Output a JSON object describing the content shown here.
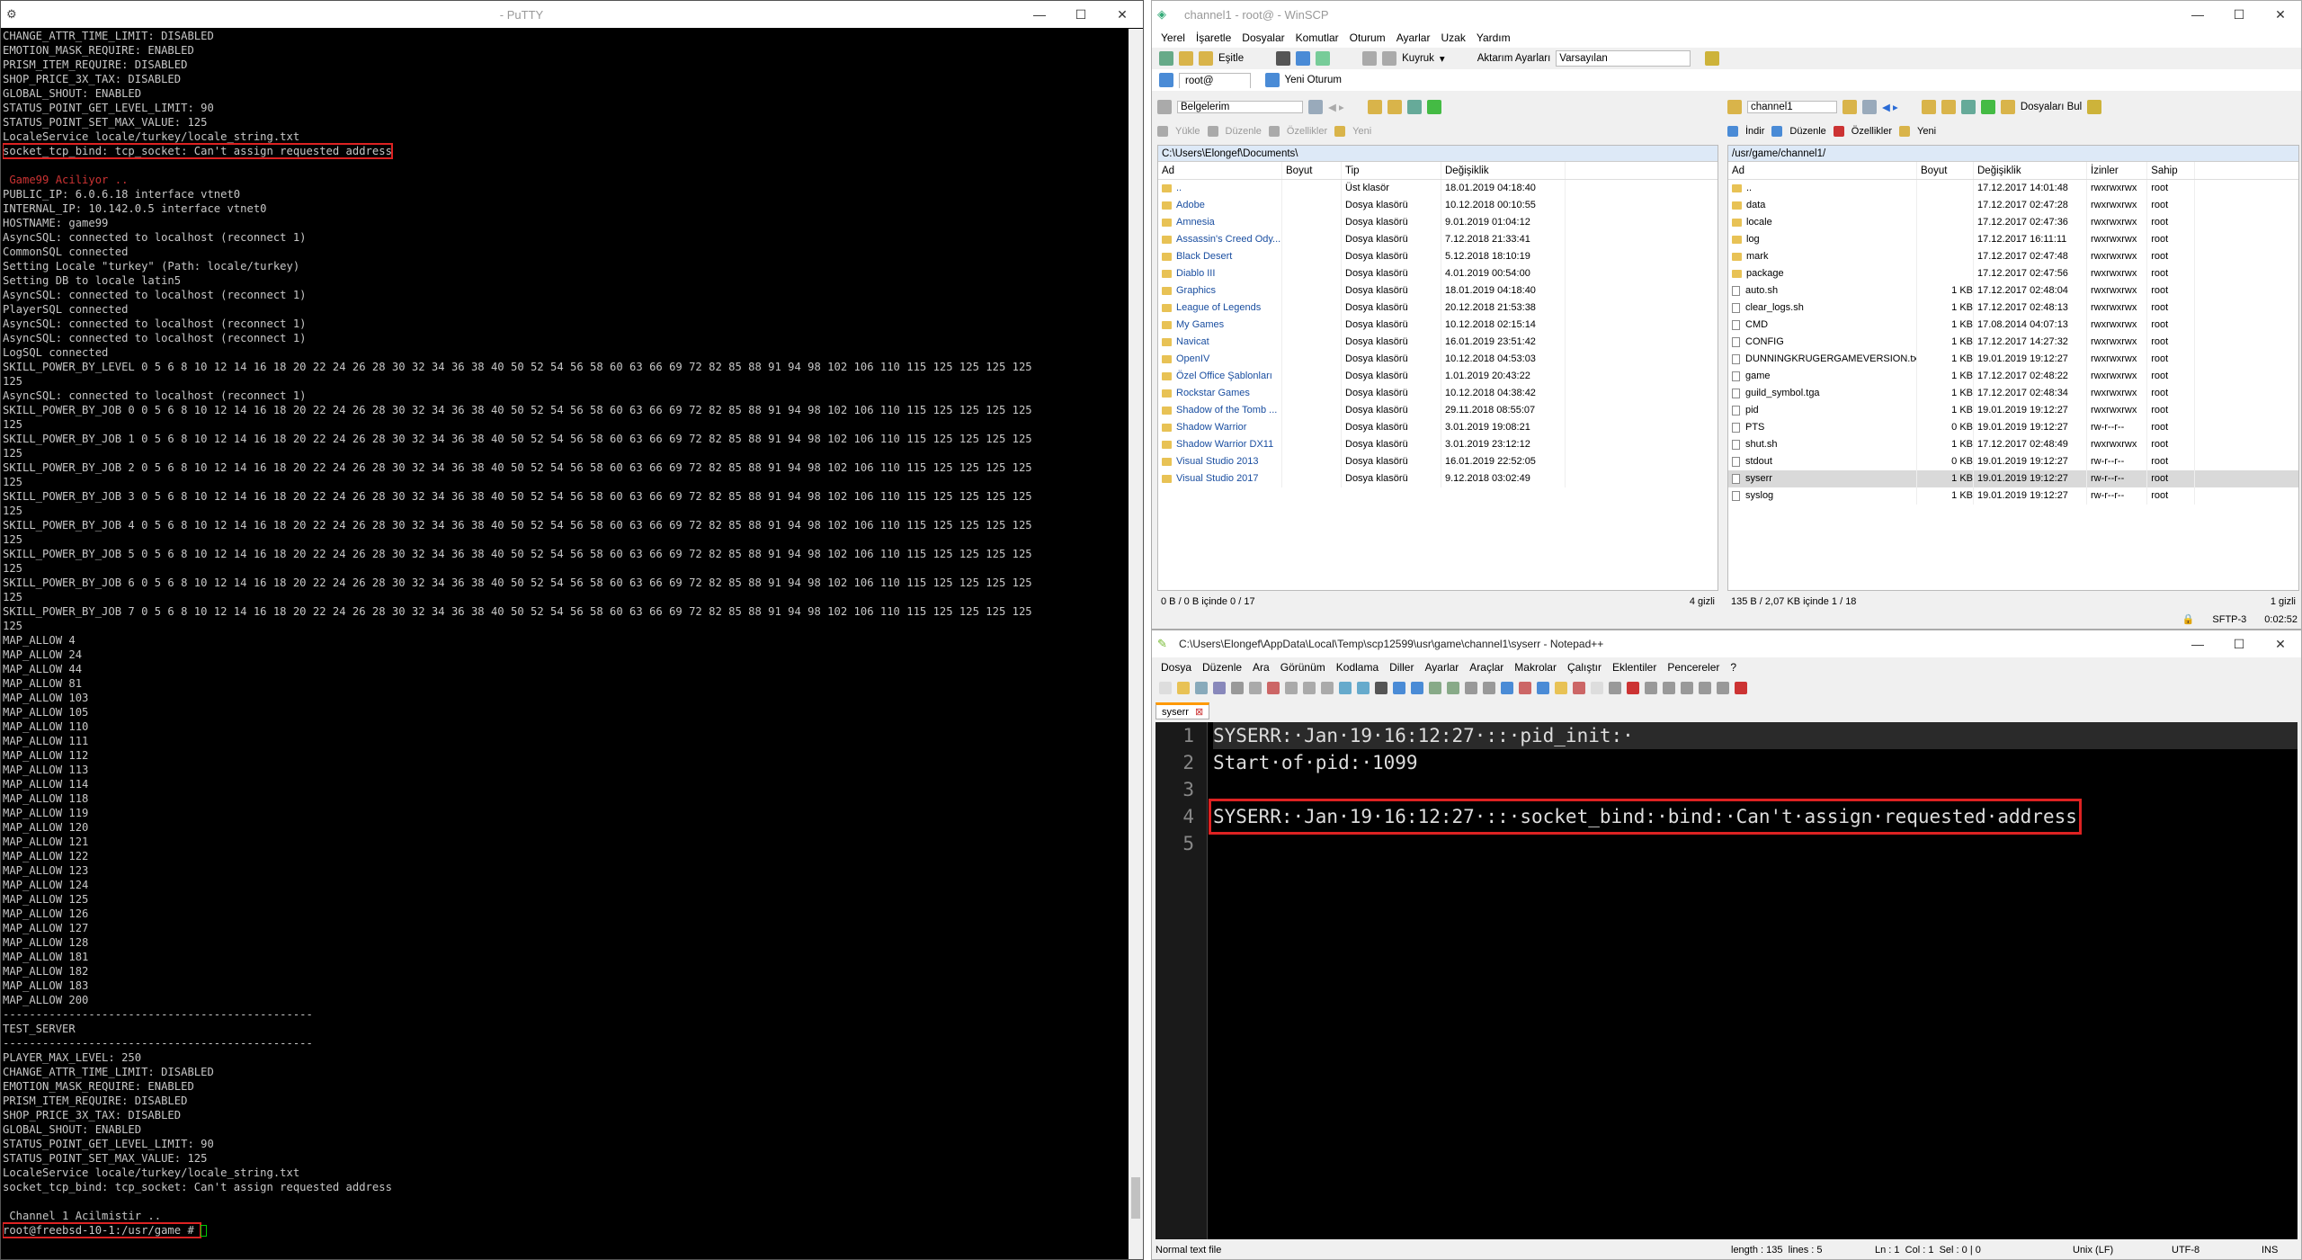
{
  "putty": {
    "title": " - PuTTY",
    "lines": [
      "CHANGE_ATTR_TIME_LIMIT: DISABLED",
      "EMOTION_MASK_REQUIRE: ENABLED",
      "PRISM_ITEM_REQUIRE: DISABLED",
      "SHOP_PRICE_3X_TAX: DISABLED",
      "GLOBAL_SHOUT: ENABLED",
      "STATUS_POINT_GET_LEVEL_LIMIT: 90",
      "STATUS_POINT_SET_MAX_VALUE: 125",
      "LocaleService locale/turkey/locale_string.txt",
      "socket_tcp_bind: tcp_socket: Can't assign requested address",
      "",
      " Game99 Aciliyor ..",
      "PUBLIC_IP: 6.0.6.18 interface vtnet0",
      "INTERNAL_IP: 10.142.0.5 interface vtnet0",
      "HOSTNAME: game99",
      "AsyncSQL: connected to localhost (reconnect 1)",
      "CommonSQL connected",
      "Setting Locale \"turkey\" (Path: locale/turkey)",
      "Setting DB to locale latin5",
      "AsyncSQL: connected to localhost (reconnect 1)",
      "PlayerSQL connected",
      "AsyncSQL: connected to localhost (reconnect 1)",
      "AsyncSQL: connected to localhost (reconnect 1)",
      "LogSQL connected",
      "SKILL_POWER_BY_LEVEL 0 5 6 8 10 12 14 16 18 20 22 24 26 28 30 32 34 36 38 40 50 52 54 56 58 60 63 66 69 72 82 85 88 91 94 98 102 106 110 115 125 125 125 125",
      "125",
      "AsyncSQL: connected to localhost (reconnect 1)",
      "SKILL_POWER_BY_JOB 0 0 5 6 8 10 12 14 16 18 20 22 24 26 28 30 32 34 36 38 40 50 52 54 56 58 60 63 66 69 72 82 85 88 91 94 98 102 106 110 115 125 125 125 125",
      "125",
      "SKILL_POWER_BY_JOB 1 0 5 6 8 10 12 14 16 18 20 22 24 26 28 30 32 34 36 38 40 50 52 54 56 58 60 63 66 69 72 82 85 88 91 94 98 102 106 110 115 125 125 125 125",
      "125",
      "SKILL_POWER_BY_JOB 2 0 5 6 8 10 12 14 16 18 20 22 24 26 28 30 32 34 36 38 40 50 52 54 56 58 60 63 66 69 72 82 85 88 91 94 98 102 106 110 115 125 125 125 125",
      "125",
      "SKILL_POWER_BY_JOB 3 0 5 6 8 10 12 14 16 18 20 22 24 26 28 30 32 34 36 38 40 50 52 54 56 58 60 63 66 69 72 82 85 88 91 94 98 102 106 110 115 125 125 125 125",
      "125",
      "SKILL_POWER_BY_JOB 4 0 5 6 8 10 12 14 16 18 20 22 24 26 28 30 32 34 36 38 40 50 52 54 56 58 60 63 66 69 72 82 85 88 91 94 98 102 106 110 115 125 125 125 125",
      "125",
      "SKILL_POWER_BY_JOB 5 0 5 6 8 10 12 14 16 18 20 22 24 26 28 30 32 34 36 38 40 50 52 54 56 58 60 63 66 69 72 82 85 88 91 94 98 102 106 110 115 125 125 125 125",
      "125",
      "SKILL_POWER_BY_JOB 6 0 5 6 8 10 12 14 16 18 20 22 24 26 28 30 32 34 36 38 40 50 52 54 56 58 60 63 66 69 72 82 85 88 91 94 98 102 106 110 115 125 125 125 125",
      "125",
      "SKILL_POWER_BY_JOB 7 0 5 6 8 10 12 14 16 18 20 22 24 26 28 30 32 34 36 38 40 50 52 54 56 58 60 63 66 69 72 82 85 88 91 94 98 102 106 110 115 125 125 125 125",
      "125",
      "MAP_ALLOW 4",
      "MAP_ALLOW 24",
      "MAP_ALLOW 44",
      "MAP_ALLOW 81",
      "MAP_ALLOW 103",
      "MAP_ALLOW 105",
      "MAP_ALLOW 110",
      "MAP_ALLOW 111",
      "MAP_ALLOW 112",
      "MAP_ALLOW 113",
      "MAP_ALLOW 114",
      "MAP_ALLOW 118",
      "MAP_ALLOW 119",
      "MAP_ALLOW 120",
      "MAP_ALLOW 121",
      "MAP_ALLOW 122",
      "MAP_ALLOW 123",
      "MAP_ALLOW 124",
      "MAP_ALLOW 125",
      "MAP_ALLOW 126",
      "MAP_ALLOW 127",
      "MAP_ALLOW 128",
      "MAP_ALLOW 181",
      "MAP_ALLOW 182",
      "MAP_ALLOW 183",
      "MAP_ALLOW 200",
      "-----------------------------------------------",
      "TEST_SERVER",
      "-----------------------------------------------",
      "PLAYER_MAX_LEVEL: 250",
      "CHANGE_ATTR_TIME_LIMIT: DISABLED",
      "EMOTION_MASK_REQUIRE: ENABLED",
      "PRISM_ITEM_REQUIRE: DISABLED",
      "SHOP_PRICE_3X_TAX: DISABLED",
      "GLOBAL_SHOUT: ENABLED",
      "STATUS_POINT_GET_LEVEL_LIMIT: 90",
      "STATUS_POINT_SET_MAX_VALUE: 125",
      "LocaleService locale/turkey/locale_string.txt",
      "socket_tcp_bind: tcp_socket: Can't assign requested address",
      "",
      " Channel 1 Acilmistir ..",
      "root@freebsd-10-1:/usr/game # "
    ],
    "red_line_indices": [
      10,
      85
    ],
    "boxed_line_indices": [
      8,
      83
    ]
  },
  "winscp": {
    "title": "channel1 - root@ - WinSCP",
    "menu": [
      "Yerel",
      "İşaretle",
      "Dosyalar",
      "Komutlar",
      "Oturum",
      "Ayarlar",
      "Uzak",
      "Yardım"
    ],
    "toolbar": {
      "sync": "Eşitle",
      "queue": "Kuyruk",
      "transfer_label": "Aktarım Ayarları",
      "transfer_value": "Varsayılan"
    },
    "tabs": {
      "session": "root@",
      "new_session": "Yeni Oturum"
    },
    "left": {
      "location": "Belgelerim",
      "actions": [
        "Yükle",
        "Düzenle",
        "Özellikler",
        "Yeni"
      ],
      "path": "C:\\Users\\Elongef\\Documents\\",
      "columns": [
        "Ad",
        "Boyut",
        "Tip",
        "Değişiklik"
      ],
      "rows": [
        [
          "..",
          "",
          "Üst klasör",
          "18.01.2019 04:18:40"
        ],
        [
          "Adobe",
          "",
          "Dosya klasörü",
          "10.12.2018 00:10:55"
        ],
        [
          "Amnesia",
          "",
          "Dosya klasörü",
          "9.01.2019 01:04:12"
        ],
        [
          "Assassin's Creed Ody...",
          "",
          "Dosya klasörü",
          "7.12.2018 21:33:41"
        ],
        [
          "Black Desert",
          "",
          "Dosya klasörü",
          "5.12.2018 18:10:19"
        ],
        [
          "Diablo III",
          "",
          "Dosya klasörü",
          "4.01.2019 00:54:00"
        ],
        [
          "Graphics",
          "",
          "Dosya klasörü",
          "18.01.2019 04:18:40"
        ],
        [
          "League of Legends",
          "",
          "Dosya klasörü",
          "20.12.2018 21:53:38"
        ],
        [
          "My Games",
          "",
          "Dosya klasörü",
          "10.12.2018 02:15:14"
        ],
        [
          "Navicat",
          "",
          "Dosya klasörü",
          "16.01.2019 23:51:42"
        ],
        [
          "OpenIV",
          "",
          "Dosya klasörü",
          "10.12.2018 04:53:03"
        ],
        [
          "Özel Office Şablonları",
          "",
          "Dosya klasörü",
          "1.01.2019 20:43:22"
        ],
        [
          "Rockstar Games",
          "",
          "Dosya klasörü",
          "10.12.2018 04:38:42"
        ],
        [
          "Shadow of the Tomb ...",
          "",
          "Dosya klasörü",
          "29.11.2018 08:55:07"
        ],
        [
          "Shadow Warrior",
          "",
          "Dosya klasörü",
          "3.01.2019 19:08:21"
        ],
        [
          "Shadow Warrior DX11",
          "",
          "Dosya klasörü",
          "3.01.2019 23:12:12"
        ],
        [
          "Visual Studio 2013",
          "",
          "Dosya klasörü",
          "16.01.2019 22:52:05"
        ],
        [
          "Visual Studio 2017",
          "",
          "Dosya klasörü",
          "9.12.2018 03:02:49"
        ]
      ],
      "status": "0 B / 0 B içinde 0 / 17",
      "hidden": "4 gizli"
    },
    "right": {
      "location": "channel1",
      "find": "Dosyaları Bul",
      "actions": [
        "İndir",
        "Düzenle",
        "Özellikler",
        "Yeni"
      ],
      "path": "/usr/game/channel1/",
      "columns": [
        "Ad",
        "Boyut",
        "Değişiklik",
        "İzinler",
        "Sahip"
      ],
      "rows": [
        [
          "..",
          "",
          "17.12.2017 14:01:48",
          "rwxrwxrwx",
          "root",
          "d"
        ],
        [
          "data",
          "",
          "17.12.2017 02:47:28",
          "rwxrwxrwx",
          "root",
          "d"
        ],
        [
          "locale",
          "",
          "17.12.2017 02:47:36",
          "rwxrwxrwx",
          "root",
          "d"
        ],
        [
          "log",
          "",
          "17.12.2017 16:11:11",
          "rwxrwxrwx",
          "root",
          "d"
        ],
        [
          "mark",
          "",
          "17.12.2017 02:47:48",
          "rwxrwxrwx",
          "root",
          "d"
        ],
        [
          "package",
          "",
          "17.12.2017 02:47:56",
          "rwxrwxrwx",
          "root",
          "d"
        ],
        [
          "auto.sh",
          "1 KB",
          "17.12.2017 02:48:04",
          "rwxrwxrwx",
          "root",
          "f"
        ],
        [
          "clear_logs.sh",
          "1 KB",
          "17.12.2017 02:48:13",
          "rwxrwxrwx",
          "root",
          "f"
        ],
        [
          "CMD",
          "1 KB",
          "17.08.2014 04:07:13",
          "rwxrwxrwx",
          "root",
          "f"
        ],
        [
          "CONFIG",
          "1 KB",
          "17.12.2017 14:27:32",
          "rwxrwxrwx",
          "root",
          "f"
        ],
        [
          "DUNNINGKRUGERGAMEVERSION.txt",
          "1 KB",
          "19.01.2019 19:12:27",
          "rwxrwxrwx",
          "root",
          "f"
        ],
        [
          "game",
          "1 KB",
          "17.12.2017 02:48:22",
          "rwxrwxrwx",
          "root",
          "f"
        ],
        [
          "guild_symbol.tga",
          "1 KB",
          "17.12.2017 02:48:34",
          "rwxrwxrwx",
          "root",
          "f"
        ],
        [
          "pid",
          "1 KB",
          "19.01.2019 19:12:27",
          "rwxrwxrwx",
          "root",
          "f"
        ],
        [
          "PTS",
          "0 KB",
          "19.01.2019 19:12:27",
          "rw-r--r--",
          "root",
          "f"
        ],
        [
          "shut.sh",
          "1 KB",
          "17.12.2017 02:48:49",
          "rwxrwxrwx",
          "root",
          "f"
        ],
        [
          "stdout",
          "0 KB",
          "19.01.2019 19:12:27",
          "rw-r--r--",
          "root",
          "f"
        ],
        [
          "syserr",
          "1 KB",
          "19.01.2019 19:12:27",
          "rw-r--r--",
          "root",
          "f"
        ],
        [
          "syslog",
          "1 KB",
          "19.01.2019 19:12:27",
          "rw-r--r--",
          "root",
          "f"
        ]
      ],
      "selected_index": 17,
      "status": "135 B / 2,07 KB içinde 1 / 18",
      "hidden": "1 gizli"
    },
    "bottom": {
      "protocol": "SFTP-3",
      "time": "0:02:52"
    }
  },
  "npp": {
    "title": "C:\\Users\\Elongef\\AppData\\Local\\Temp\\scp12599\\usr\\game\\channel1\\syserr - Notepad++",
    "menu": [
      "Dosya",
      "Düzenle",
      "Ara",
      "Görünüm",
      "Kodlama",
      "Diller",
      "Ayarlar",
      "Araçlar",
      "Makrolar",
      "Çalıştır",
      "Eklentiler",
      "Pencereler",
      "?"
    ],
    "tab": "syserr",
    "lines": [
      "SYSERR:·Jan·19·16:12:27·::·pid_init:·",
      "Start·of·pid:·1099",
      "",
      "SYSERR:·Jan·19·16:12:27·::·socket_bind:·bind:·Can't·assign·requested·address",
      ""
    ],
    "line_numbers": [
      "1",
      "2",
      "3",
      "4",
      "5"
    ],
    "boxed_line_index": 3,
    "status": {
      "type": "Normal text file",
      "length": "length : 135",
      "lines": "lines : 5",
      "ln": "Ln : 1",
      "col": "Col : 1",
      "sel": "Sel : 0 | 0",
      "eol": "Unix (LF)",
      "enc": "UTF-8",
      "mode": "INS"
    }
  }
}
